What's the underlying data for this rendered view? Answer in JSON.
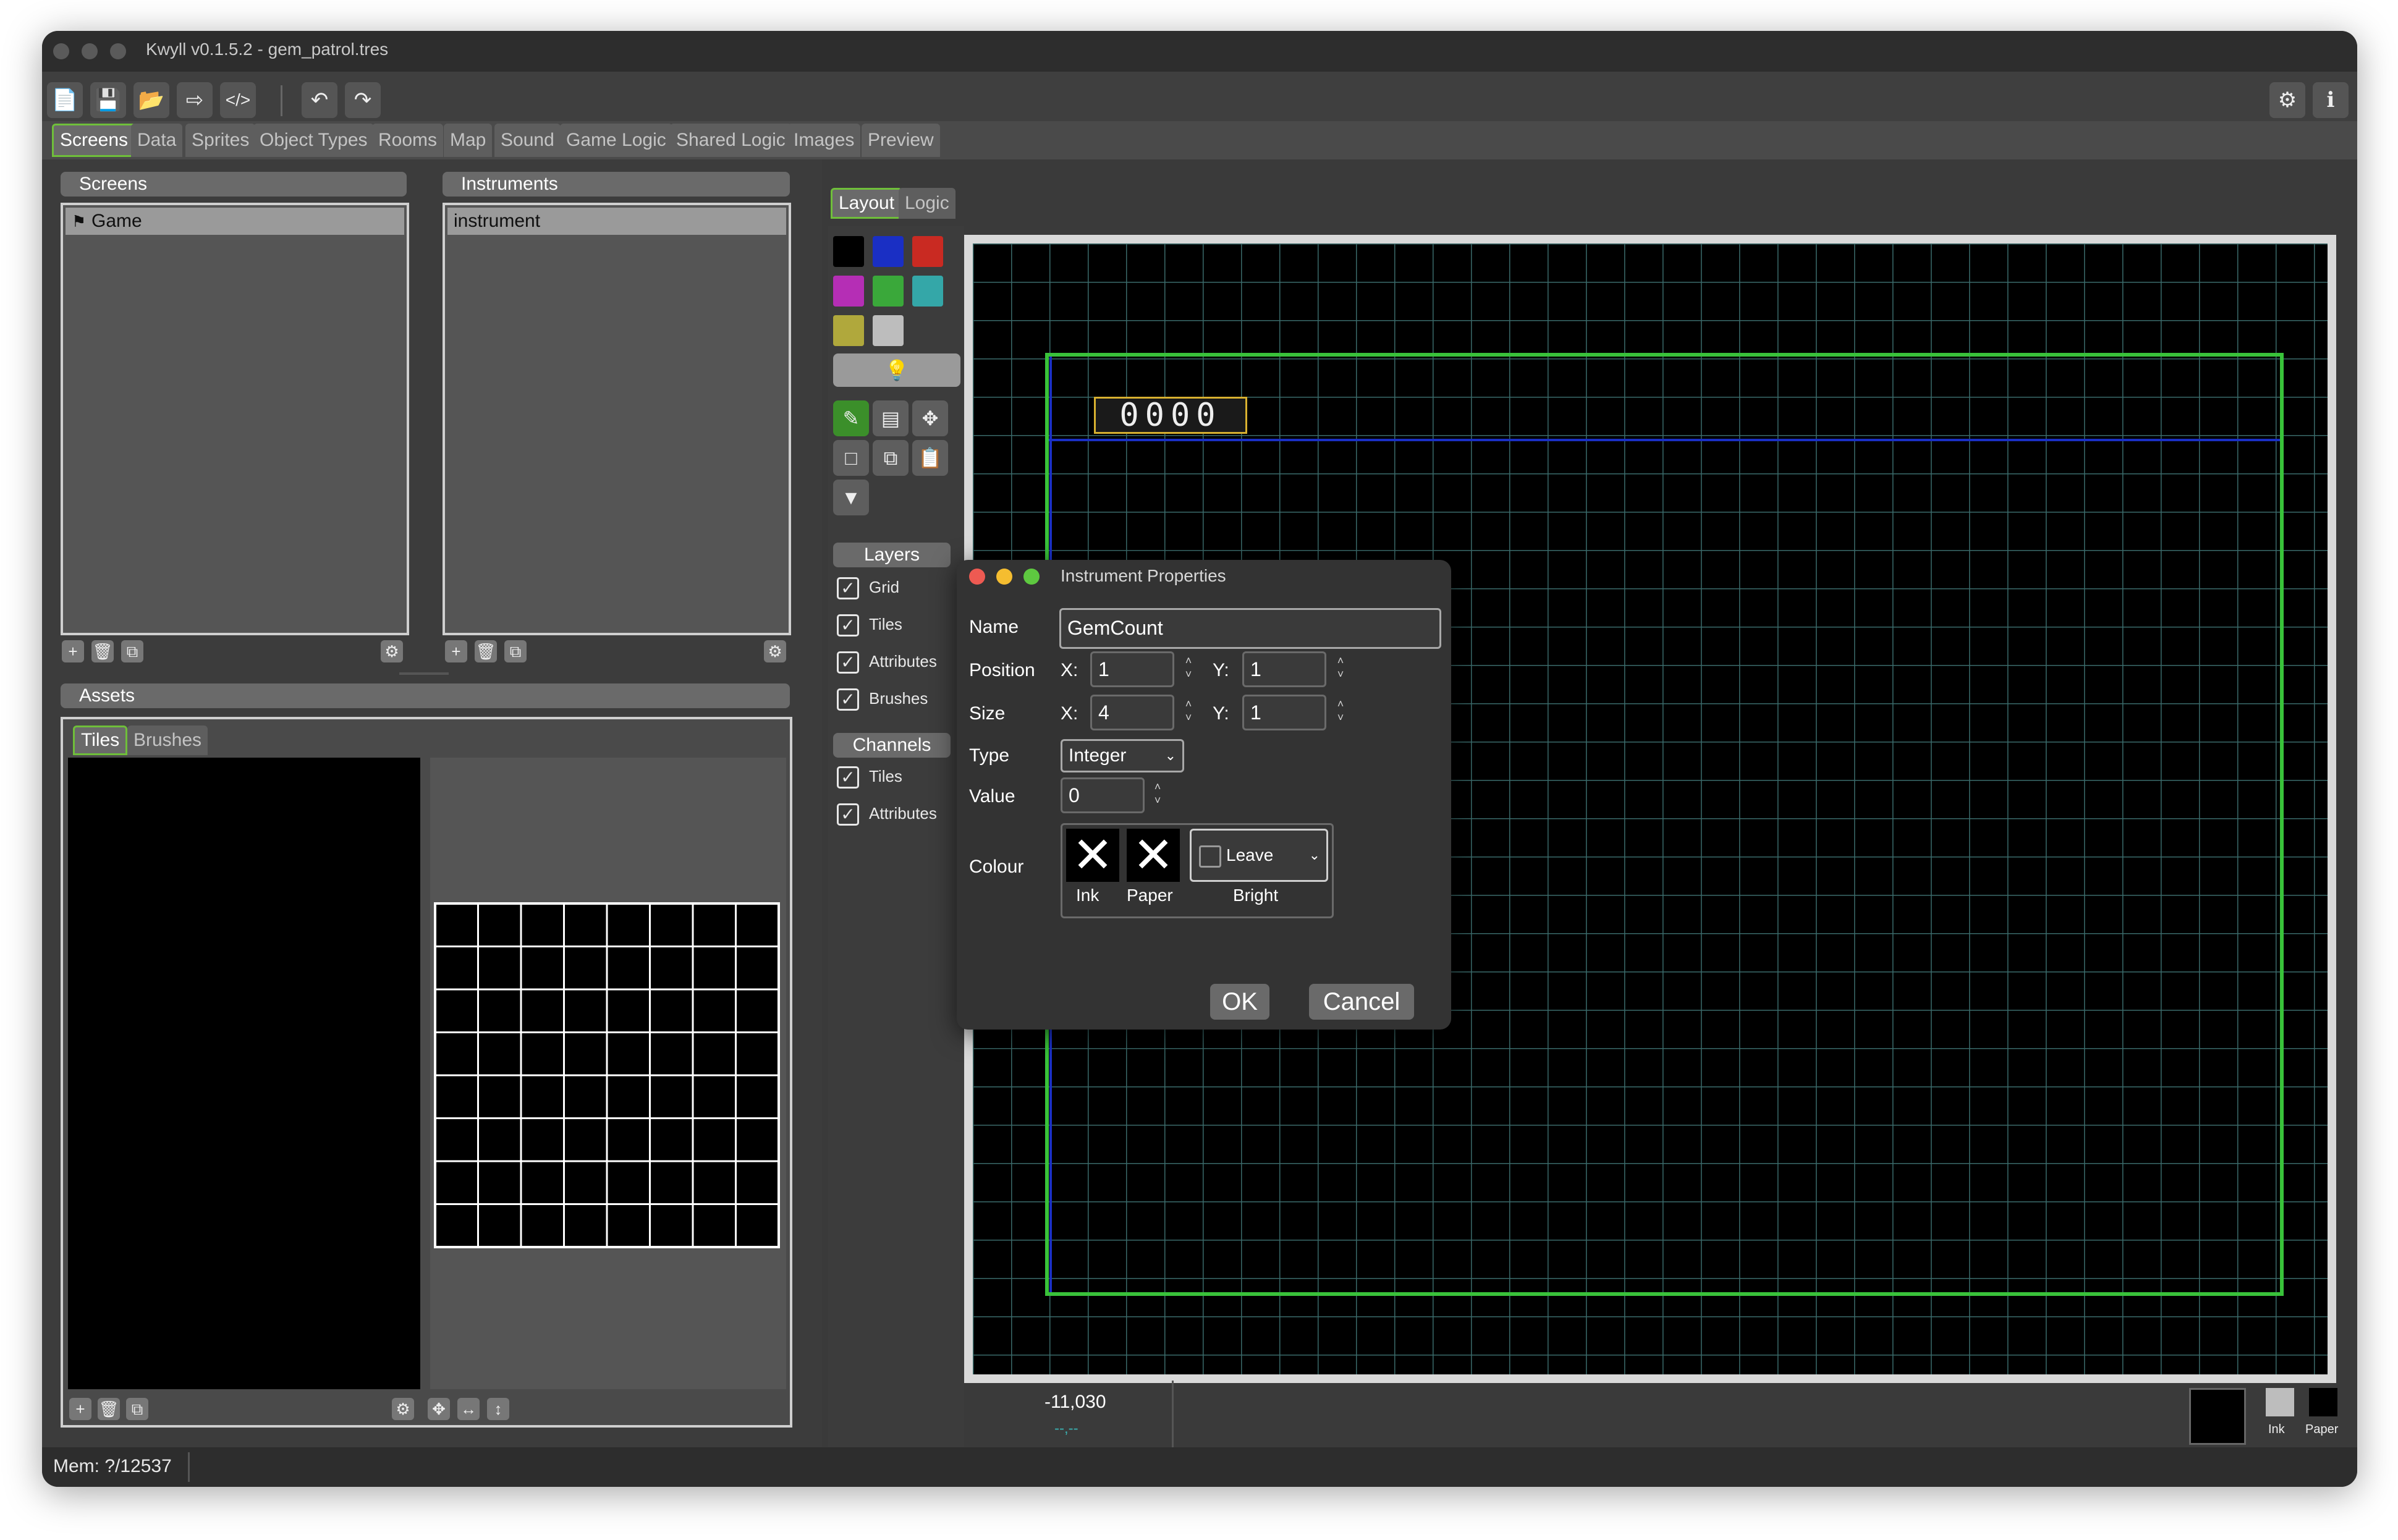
{
  "window": {
    "title": "Kwyll v0.1.5.2 - gem_patrol.tres"
  },
  "toolbar": {
    "buttons": [
      "new-file-icon",
      "save-icon",
      "open-folder-icon",
      "export-icon",
      "code-icon",
      "undo-icon",
      "redo-icon"
    ],
    "right_buttons": [
      "gear-icon",
      "info-icon"
    ]
  },
  "tabs": [
    "Screens",
    "Data",
    "Sprites",
    "Object Types",
    "Rooms",
    "Map",
    "Sound",
    "Game Logic",
    "Shared Logic",
    "Images",
    "Preview"
  ],
  "screens_panel": {
    "title": "Screens",
    "items": [
      "Game"
    ]
  },
  "instruments_panel": {
    "title": "Instruments",
    "items": [
      "instrument"
    ]
  },
  "assets_panel": {
    "title": "Assets",
    "tabs": [
      "Tiles",
      "Brushes"
    ]
  },
  "editor_tabs": [
    "Layout",
    "Logic"
  ],
  "palette_colors": [
    "#000000",
    "#1a2fc4",
    "#c92a22",
    "#b52eb5",
    "#3aa83a",
    "#34a7a8",
    "#b0a83c",
    "#bdbdbd"
  ],
  "layers": {
    "title": "Layers",
    "items": [
      {
        "label": "Grid",
        "checked": true
      },
      {
        "label": "Tiles",
        "checked": true
      },
      {
        "label": "Attributes",
        "checked": true
      },
      {
        "label": "Brushes",
        "checked": true
      }
    ]
  },
  "channels": {
    "title": "Channels",
    "items": [
      {
        "label": "Tiles",
        "checked": true
      },
      {
        "label": "Attributes",
        "checked": true
      }
    ]
  },
  "canvas": {
    "instrument_text": "0000"
  },
  "status": {
    "coords": "-11,030",
    "line2": "--,--",
    "line3": "--,--",
    "ink_label": "Ink",
    "paper_label": "Paper",
    "memory": "Mem: ?/12537"
  },
  "dialog": {
    "title": "Instrument Properties",
    "name_label": "Name",
    "name_value": "GemCount",
    "position_label": "Position",
    "size_label": "Size",
    "x_label": "X:",
    "y_label": "Y:",
    "position_x": "1",
    "position_y": "1",
    "size_x": "4",
    "size_y": "1",
    "type_label": "Type",
    "type_value": "Integer",
    "value_label": "Value",
    "value_value": "0",
    "colour_label": "Colour",
    "ink_label": "Ink",
    "paper_label": "Paper",
    "bright_label": "Bright",
    "bright_value": "Leave",
    "ok_label": "OK",
    "cancel_label": "Cancel"
  }
}
